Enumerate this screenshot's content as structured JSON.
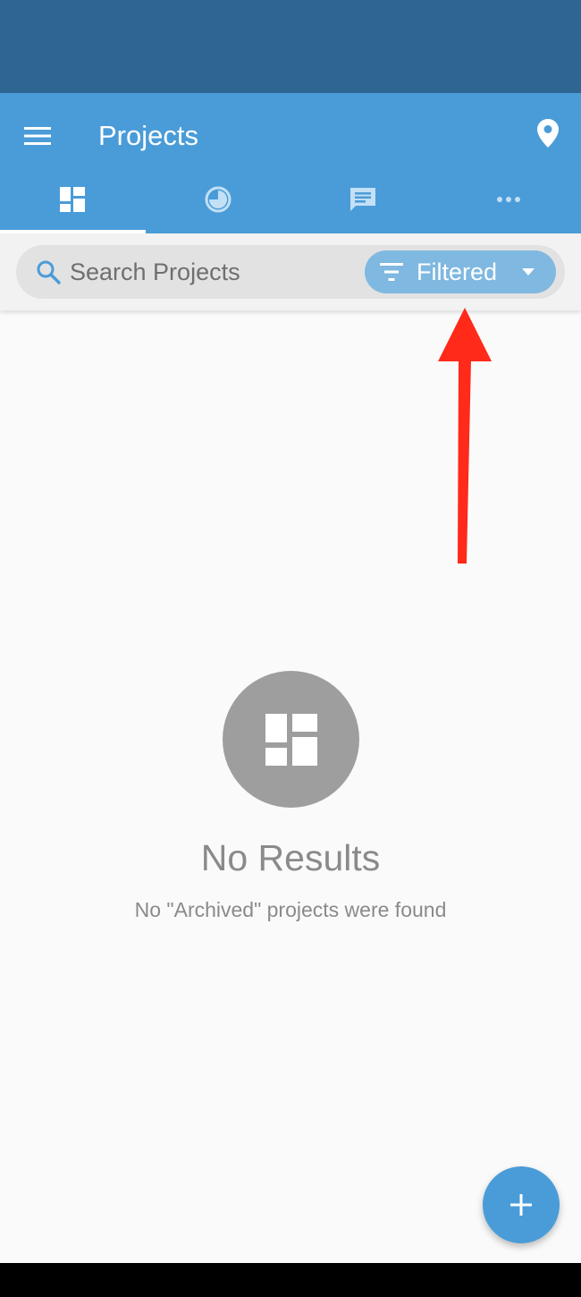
{
  "app_bar": {
    "title": "Projects",
    "menu_icon": "hamburger-menu-icon",
    "location_icon": "map-pin-icon"
  },
  "tabs": [
    {
      "icon": "dashboard-icon",
      "active": true
    },
    {
      "icon": "clock-icon",
      "active": false
    },
    {
      "icon": "chat-icon",
      "active": false
    },
    {
      "icon": "more-horizontal-icon",
      "active": false
    }
  ],
  "search": {
    "placeholder": "Search Projects",
    "value": ""
  },
  "filter": {
    "label": "Filtered"
  },
  "empty_state": {
    "icon": "dashboard-icon",
    "title": "No Results",
    "subtitle": "No \"Archived\" projects were found"
  },
  "fab": {
    "icon": "plus-icon"
  },
  "colors": {
    "status_bar": "#2d6690",
    "primary": "#4a9cd8",
    "filter_chip": "#7fb8e0",
    "annotation_arrow": "#ff2a1a",
    "empty_icon_bg": "#9e9e9e"
  }
}
